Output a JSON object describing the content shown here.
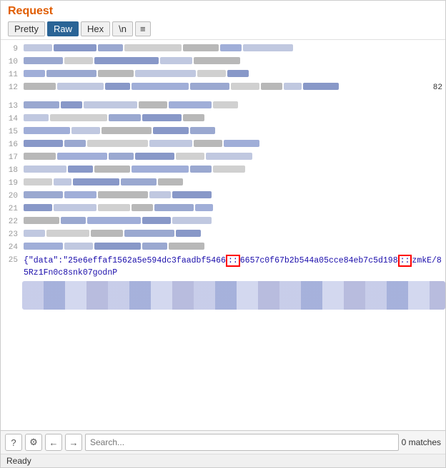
{
  "header": {
    "title": "Request",
    "tabs": [
      {
        "label": "Pretty",
        "active": false
      },
      {
        "label": "Raw",
        "active": true
      },
      {
        "label": "Hex",
        "active": false
      },
      {
        "label": "\\n",
        "active": false
      }
    ],
    "menu_icon": "≡"
  },
  "lines": [
    {
      "num": "9",
      "has_data": true
    },
    {
      "num": "10",
      "has_data": true
    },
    {
      "num": "11",
      "has_data": true
    },
    {
      "num": "12",
      "has_data": true,
      "suffix": "82"
    },
    {
      "num": "",
      "has_data": false
    },
    {
      "num": "13",
      "has_data": true
    },
    {
      "num": "14",
      "has_data": true
    },
    {
      "num": "15",
      "has_data": true
    },
    {
      "num": "16",
      "has_data": true
    },
    {
      "num": "17",
      "has_data": true
    },
    {
      "num": "18",
      "has_data": true
    },
    {
      "num": "19",
      "has_data": true
    },
    {
      "num": "20",
      "has_data": true
    },
    {
      "num": "21",
      "has_data": true
    },
    {
      "num": "22",
      "has_data": true
    },
    {
      "num": "23",
      "has_data": true
    },
    {
      "num": "24",
      "has_data": true
    },
    {
      "num": "25",
      "has_data": false,
      "special": true,
      "text_before": "{\"data\":\"25e6effaf1562a5e594dc3faadbf5466",
      "highlight1": "::",
      "text_mid": "6657c0f67b2b544a05cce84eb7c5d198",
      "highlight2": "::",
      "text_after": "zmkE/85Rz1Fn0c8snk07godnP"
    }
  ],
  "footer": {
    "help_icon": "?",
    "settings_icon": "⚙",
    "back_icon": "←",
    "forward_icon": "→",
    "search_placeholder": "Search...",
    "matches": "0 matches"
  },
  "status_bar": {
    "text": "Ready"
  }
}
